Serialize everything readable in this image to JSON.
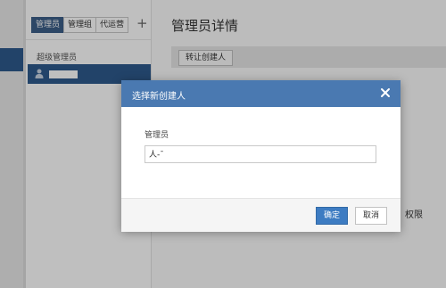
{
  "sidebar": {
    "tabs": [
      "管理员",
      "管理组",
      "代运营"
    ],
    "add_symbol": "+",
    "group_label": "超级管理员"
  },
  "main": {
    "title": "管理员详情",
    "transfer_button": "转让创建人",
    "permission_snippet": "权限"
  },
  "modal": {
    "title": "选择新创建人",
    "field_label": "管理员",
    "field_value": "人-ˉ",
    "ok_label": "确定",
    "cancel_label": "取消"
  },
  "colors": {
    "header_blue": "#4a79b1",
    "selected_row": "#2e5a8c",
    "ok_button": "#3d7cc2"
  },
  "icons": [
    "close-icon",
    "user-icon",
    "plus-icon"
  ]
}
